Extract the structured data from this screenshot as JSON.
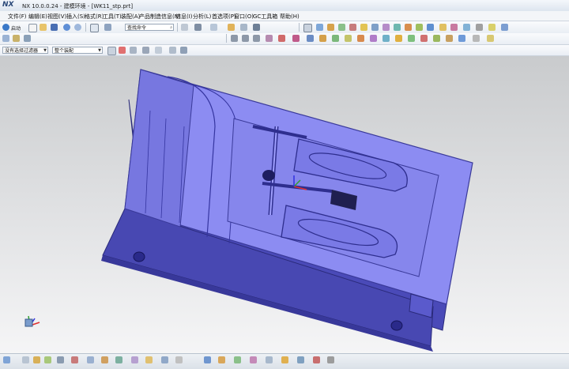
{
  "title_bar": {
    "logo": "NX",
    "title": "NX 10.0.0.24 - 建模环境 - [WK11_stp.prt]"
  },
  "menu": {
    "items": [
      "文件(F)",
      "编辑(E)",
      "视图(V)",
      "插入(S)",
      "格式(R)",
      "工具(T)",
      "装配(A)",
      "产品制造信息(N)",
      "信息(I)",
      "分析(L)",
      "首选项(P)",
      "窗口(O)",
      "GC工具箱",
      "帮助(H)"
    ]
  },
  "toolbar": {
    "start_label": "启动",
    "command_search_placeholder": "查找命令"
  },
  "selection_bar": {
    "filter_value": "没有选择过滤器",
    "scope_value": "整个装配"
  },
  "colors": {
    "part_top": "#8c8cf2",
    "part_side": "#4a4ab8",
    "viewport_top": "#c9cbcd",
    "viewport_bottom": "#f6f6f7"
  }
}
